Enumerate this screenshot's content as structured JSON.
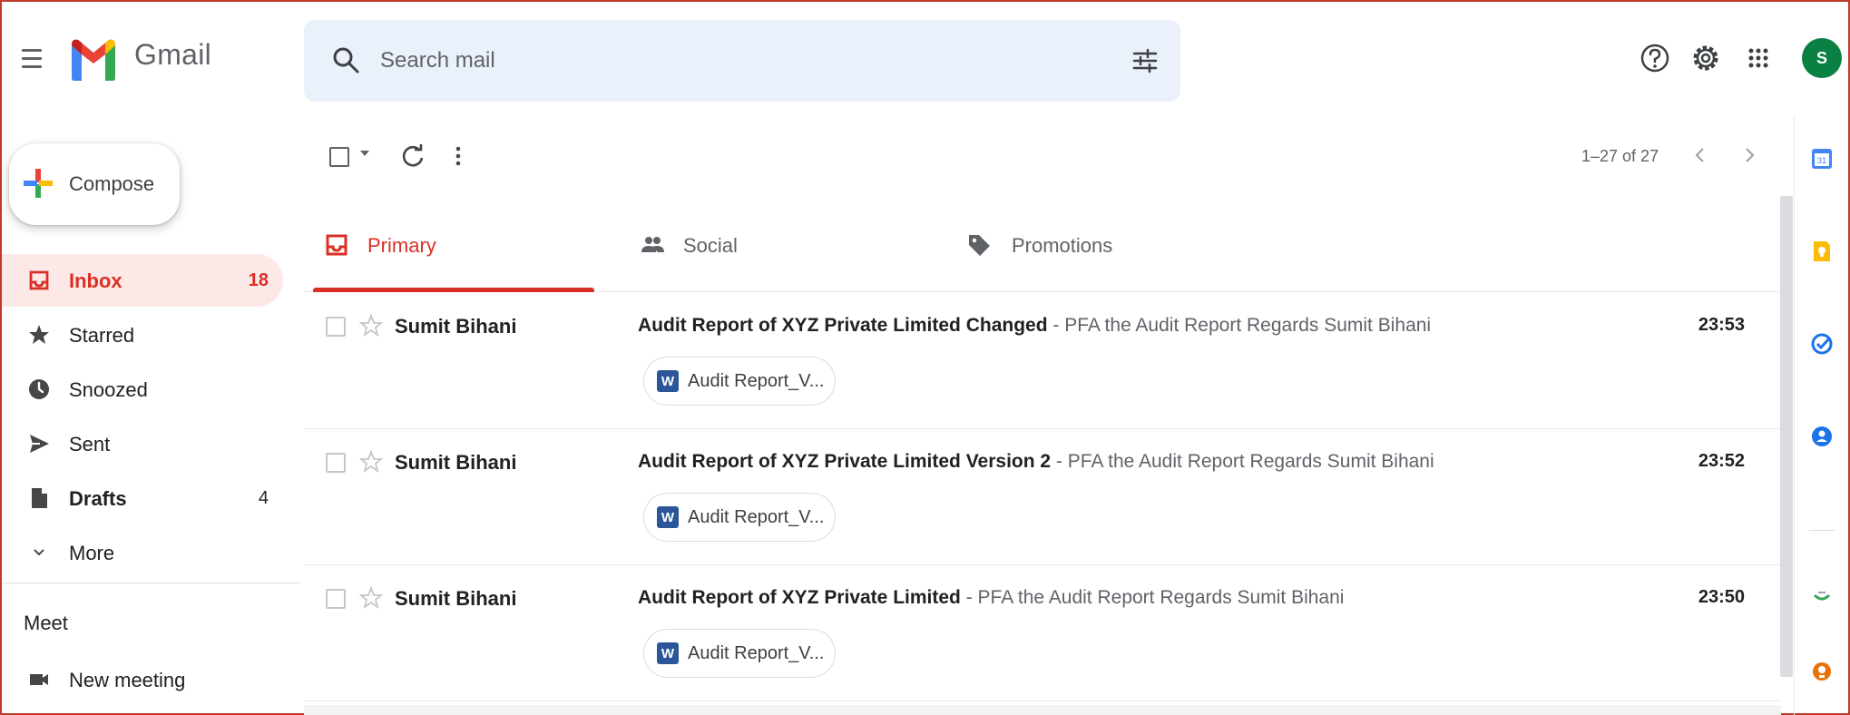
{
  "app": {
    "name": "Gmail",
    "avatar_initial": "S",
    "brand_colors": {
      "red": "#ea4335",
      "blue": "#4285f4",
      "green": "#34a853",
      "yellow": "#fbbc04",
      "active": "#d93025"
    }
  },
  "search": {
    "placeholder": "Search mail"
  },
  "header_icons": [
    "help-icon",
    "settings-icon",
    "apps-icon"
  ],
  "compose": {
    "label": "Compose"
  },
  "sidebar": {
    "items": [
      {
        "label": "Inbox",
        "count": "18",
        "icon": "inbox-icon",
        "active": true
      },
      {
        "label": "Starred",
        "count": "",
        "icon": "star-icon",
        "active": false
      },
      {
        "label": "Snoozed",
        "count": "",
        "icon": "clock-icon",
        "active": false
      },
      {
        "label": "Sent",
        "count": "",
        "icon": "send-icon",
        "active": false
      },
      {
        "label": "Drafts",
        "count": "4",
        "icon": "draft-icon",
        "active": false
      },
      {
        "label": "More",
        "count": "",
        "icon": "chevron-down-icon",
        "active": false
      }
    ],
    "meet": {
      "title": "Meet",
      "new_meeting": "New meeting"
    }
  },
  "toolbar": {
    "pagination": "1–27 of 27"
  },
  "tabs": [
    {
      "label": "Primary",
      "icon": "inbox-icon",
      "active": true
    },
    {
      "label": "Social",
      "icon": "people-icon",
      "active": false
    },
    {
      "label": "Promotions",
      "icon": "tag-icon",
      "active": false
    }
  ],
  "emails": [
    {
      "sender": "Sumit Bihani",
      "subject": "Audit Report of XYZ Private Limited Changed",
      "separator": " - ",
      "snippet": "PFA the Audit Report Regards Sumit Bihani",
      "time": "23:53",
      "attachment": "Audit Report_V...",
      "attachment_type": "W"
    },
    {
      "sender": "Sumit Bihani",
      "subject": "Audit Report of XYZ Private Limited Version 2",
      "separator": " - ",
      "snippet": "PFA the Audit Report Regards Sumit Bihani",
      "time": "23:52",
      "attachment": "Audit Report_V...",
      "attachment_type": "W"
    },
    {
      "sender": "Sumit Bihani",
      "subject": "Audit Report of XYZ Private Limited",
      "separator": " - ",
      "snippet": "PFA the Audit Report Regards Sumit Bihani",
      "time": "23:50",
      "attachment": "Audit Report_V...",
      "attachment_type": "W"
    }
  ],
  "side_panel": [
    "calendar-icon",
    "keep-icon",
    "tasks-icon",
    "contacts-icon",
    "addon-icon",
    "addon-icon"
  ]
}
